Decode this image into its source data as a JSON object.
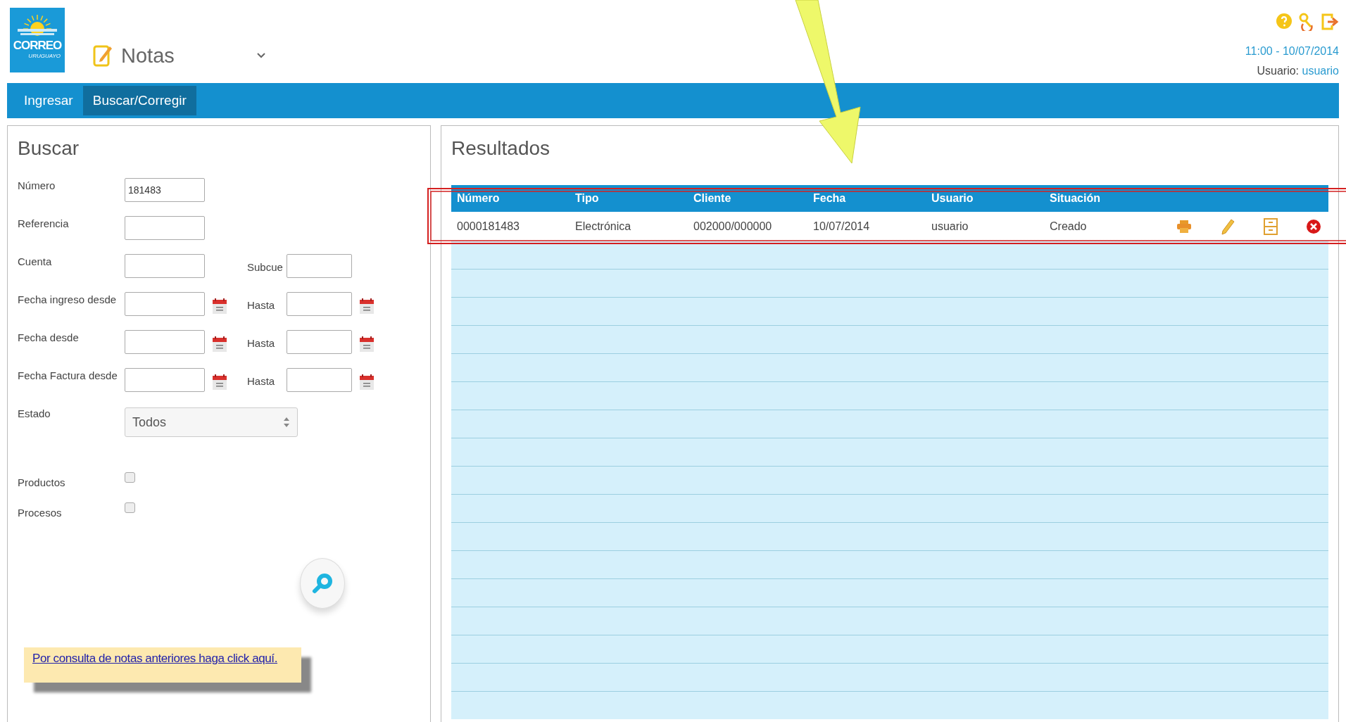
{
  "header": {
    "logo": {
      "title": "CORREO",
      "subtitle": "URUGUAYO"
    },
    "module": "Notas",
    "datetime": "11:00 - 10/07/2014",
    "user_label": "Usuario:",
    "user": "usuario"
  },
  "tabs": [
    {
      "label": "Ingresar",
      "selected": false
    },
    {
      "label": "Buscar/Corregir",
      "selected": true
    }
  ],
  "search_panel": {
    "title": "Buscar",
    "fields": [
      {
        "label": "Número",
        "value": "181483",
        "calendar": false
      },
      {
        "label": "Referencia",
        "calendar": false
      },
      {
        "label": "Cuenta",
        "calendar": false,
        "second_label": "Subcue"
      },
      {
        "label": "Fecha ingreso desde",
        "calendar": true,
        "second_label": "Hasta"
      },
      {
        "label": "Fecha desde",
        "calendar": true,
        "second_label": "Hasta"
      },
      {
        "label": "Fecha Factura desde",
        "calendar": true,
        "second_label": "Hasta"
      }
    ],
    "estado": {
      "label": "Estado",
      "value": "Todos"
    },
    "checkboxes": [
      {
        "label": "Productos",
        "checked": false
      },
      {
        "label": "Procesos",
        "checked": false
      }
    ],
    "link": "Por consulta de notas anteriores haga click aquí."
  },
  "results_panel": {
    "title": "Resultados",
    "columns": [
      "Número",
      "Tipo",
      "Cliente",
      "Fecha",
      "Usuario",
      "Situación"
    ],
    "rows": [
      {
        "cells": [
          "0000181483",
          "Electrónica",
          "002000/000000",
          "10/07/2014",
          "usuario",
          "Creado"
        ]
      }
    ]
  }
}
